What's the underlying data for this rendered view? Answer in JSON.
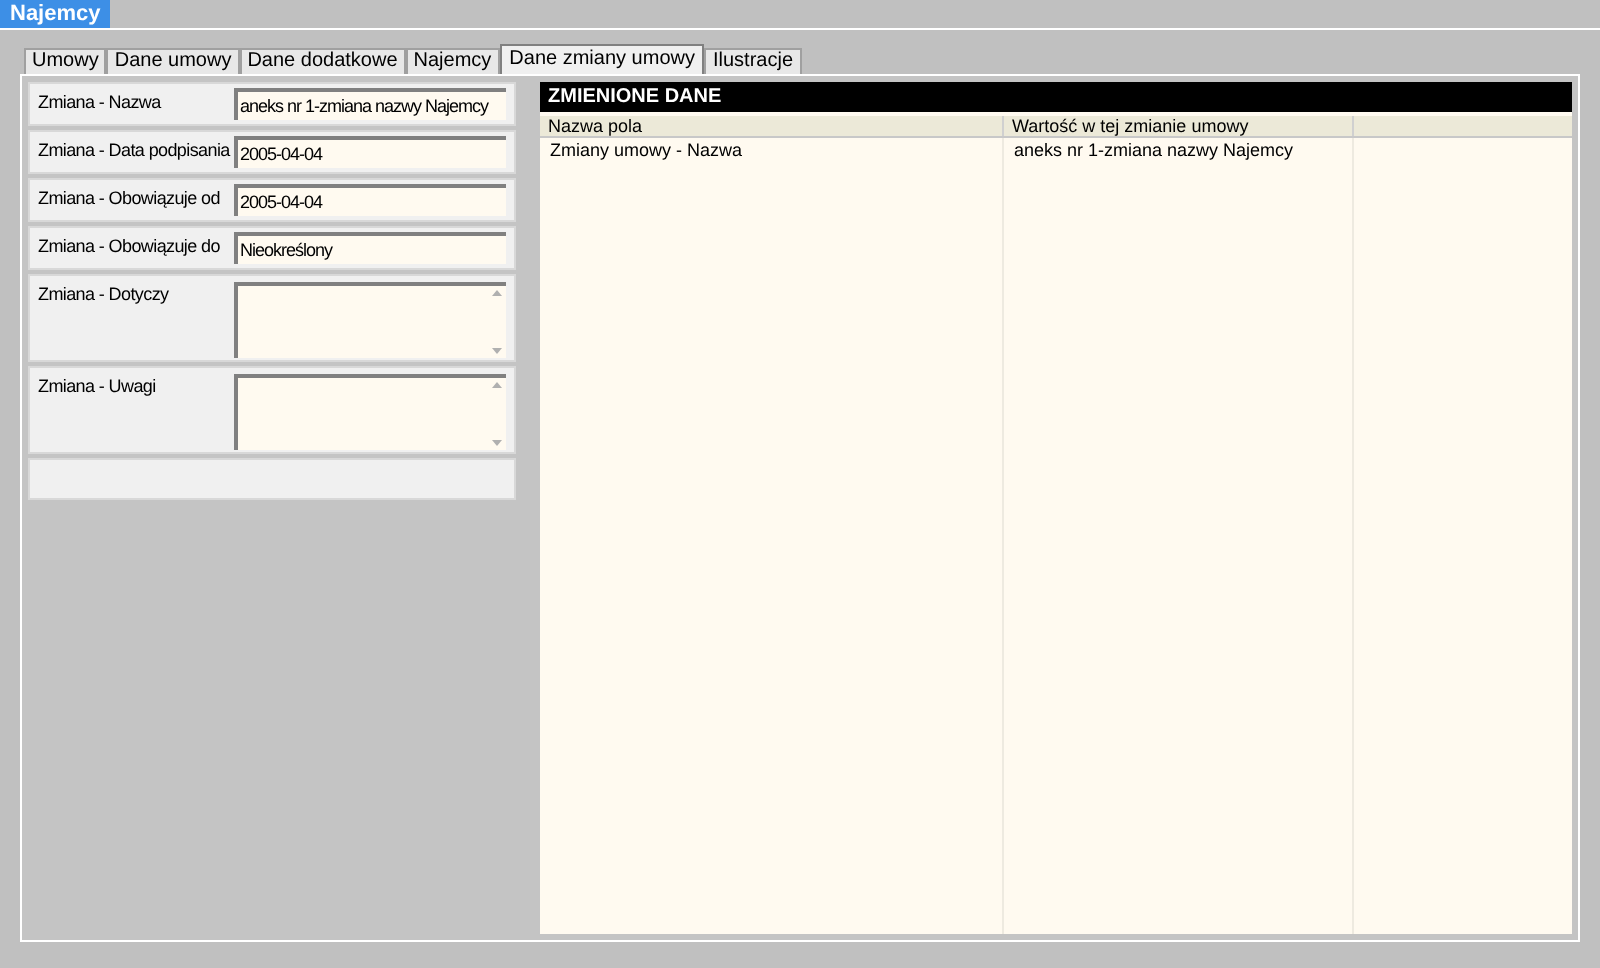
{
  "window": {
    "title": "Najemcy"
  },
  "tabs": [
    {
      "label": "Umowy",
      "selected": false
    },
    {
      "label": "Dane umowy",
      "selected": false
    },
    {
      "label": "Dane dodatkowe",
      "selected": false
    },
    {
      "label": "Najemcy",
      "selected": false
    },
    {
      "label": "Dane zmiany umowy",
      "selected": true
    },
    {
      "label": "Ilustracje",
      "selected": false
    }
  ],
  "fields": [
    {
      "kind": "text",
      "label": "Zmiana - Nazwa",
      "value": "aneks nr 1-zmiana nazwy Najemcy"
    },
    {
      "kind": "text",
      "label": "Zmiana - Data podpisania",
      "value": "2005-04-04"
    },
    {
      "kind": "text",
      "label": "Zmiana - Obowiązuje od",
      "value": "2005-04-04"
    },
    {
      "kind": "text",
      "label": "Zmiana - Obowiązuje do",
      "value": "Nieokreślony"
    },
    {
      "kind": "memo",
      "label": "Zmiana - Dotyczy"
    },
    {
      "kind": "memo",
      "label": "Zmiana - Uwagi"
    }
  ],
  "changes": {
    "title": "ZMIENIONE DANE",
    "columns": [
      "Nazwa pola",
      "Wartość w tej zmianie umowy"
    ],
    "rows": [
      [
        "Zmiany umowy - Nazwa",
        "aneks nr 1-zmiana nazwy Najemcy"
      ]
    ]
  }
}
